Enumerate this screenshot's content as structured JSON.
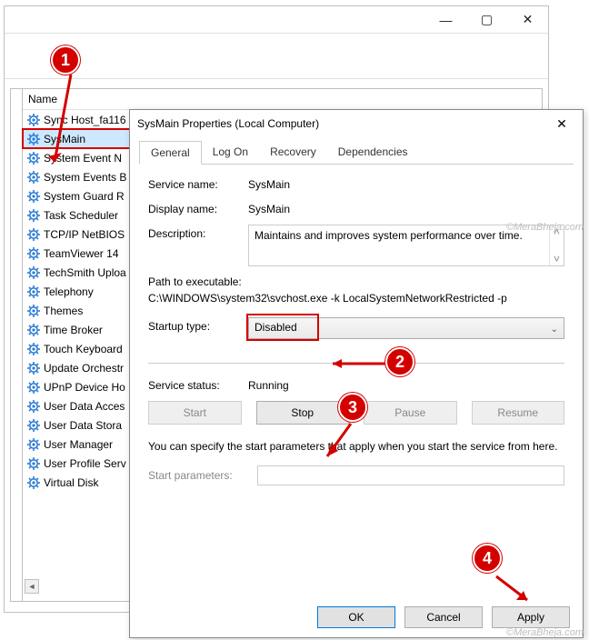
{
  "outer_window": {
    "list_header": "Name",
    "services": [
      "Sync Host_fa116",
      "SysMain",
      "System Event N",
      "System Events B",
      "System Guard R",
      "Task Scheduler",
      "TCP/IP NetBIOS",
      "TeamViewer 14",
      "TechSmith Uploa",
      "Telephony",
      "Themes",
      "Time Broker",
      "Touch Keyboard",
      "Update Orchestr",
      "UPnP Device Ho",
      "User Data Acces",
      "User Data Stora",
      "User Manager",
      "User Profile Serv",
      "Virtual Disk"
    ],
    "selected_index": 1,
    "highlight_index": 1
  },
  "props": {
    "title": "SysMain Properties (Local Computer)",
    "tabs": [
      "General",
      "Log On",
      "Recovery",
      "Dependencies"
    ],
    "active_tab": 0,
    "service_name_label": "Service name:",
    "service_name": "SysMain",
    "display_name_label": "Display name:",
    "display_name": "SysMain",
    "description_label": "Description:",
    "description": "Maintains and improves system performance over time.",
    "path_label": "Path to executable:",
    "path": "C:\\WINDOWS\\system32\\svchost.exe -k LocalSystemNetworkRestricted -p",
    "startup_label": "Startup type:",
    "startup_value": "Disabled",
    "status_label": "Service status:",
    "status_value": "Running",
    "buttons": {
      "start": "Start",
      "stop": "Stop",
      "pause": "Pause",
      "resume": "Resume"
    },
    "spec_text": "You can specify the start parameters that apply when you start the service from here.",
    "start_params_label": "Start parameters:",
    "start_params_value": "",
    "footer": {
      "ok": "OK",
      "cancel": "Cancel",
      "apply": "Apply"
    }
  },
  "callouts": {
    "c1": "1",
    "c2": "2",
    "c3": "3",
    "c4": "4"
  },
  "watermark": "©MeraBheja.com"
}
